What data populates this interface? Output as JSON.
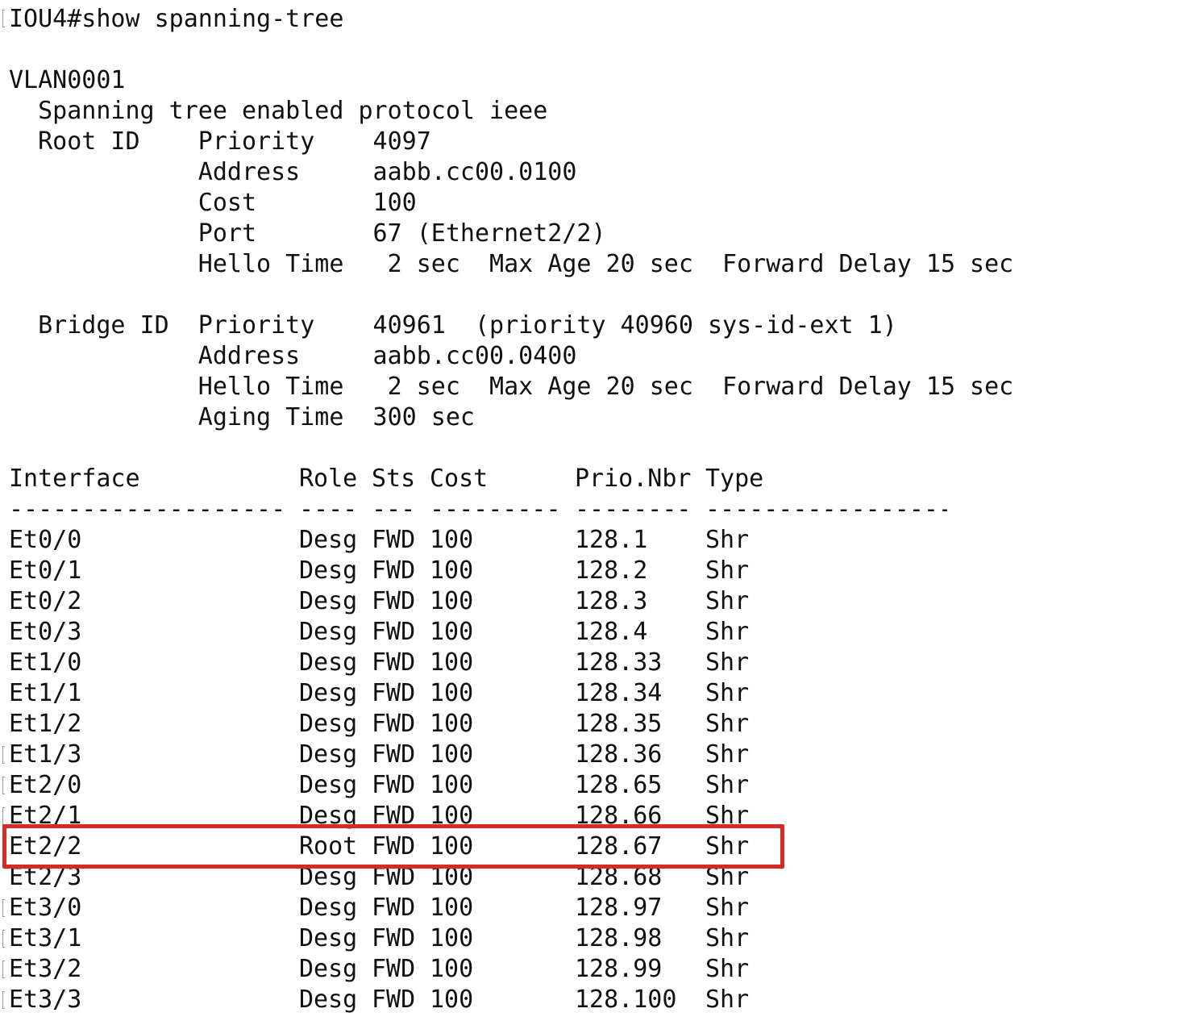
{
  "prompt_line": "IOU4#show spanning-tree",
  "vlan": {
    "name": "VLAN0001",
    "protocol_line": "  Spanning tree enabled protocol ieee",
    "root_lines": [
      "  Root ID    Priority    4097",
      "             Address     aabb.cc00.0100",
      "             Cost        100",
      "             Port        67 (Ethernet2/2)",
      "             Hello Time   2 sec  Max Age 20 sec  Forward Delay 15 sec"
    ],
    "bridge_lines": [
      "  Bridge ID  Priority    40961  (priority 40960 sys-id-ext 1)",
      "             Address     aabb.cc00.0400",
      "             Hello Time   2 sec  Max Age 20 sec  Forward Delay 15 sec",
      "             Aging Time  300 sec"
    ]
  },
  "table": {
    "headers": {
      "interface": "Interface",
      "role": "Role",
      "sts": "Sts",
      "cost": "Cost",
      "prio": "Prio.Nbr",
      "type": "Type"
    },
    "separators": {
      "interface": "-------------------",
      "role": "----",
      "sts": "---",
      "cost": "---------",
      "prio": "--------",
      "type": "--------------------------------"
    },
    "rows": [
      {
        "interface": "Et0/0",
        "role": "Desg",
        "sts": "FWD",
        "cost": "100",
        "prio": "128.1",
        "type": "Shr"
      },
      {
        "interface": "Et0/1",
        "role": "Desg",
        "sts": "FWD",
        "cost": "100",
        "prio": "128.2",
        "type": "Shr"
      },
      {
        "interface": "Et0/2",
        "role": "Desg",
        "sts": "FWD",
        "cost": "100",
        "prio": "128.3",
        "type": "Shr"
      },
      {
        "interface": "Et0/3",
        "role": "Desg",
        "sts": "FWD",
        "cost": "100",
        "prio": "128.4",
        "type": "Shr"
      },
      {
        "interface": "Et1/0",
        "role": "Desg",
        "sts": "FWD",
        "cost": "100",
        "prio": "128.33",
        "type": "Shr"
      },
      {
        "interface": "Et1/1",
        "role": "Desg",
        "sts": "FWD",
        "cost": "100",
        "prio": "128.34",
        "type": "Shr"
      },
      {
        "interface": "Et1/2",
        "role": "Desg",
        "sts": "FWD",
        "cost": "100",
        "prio": "128.35",
        "type": "Shr"
      },
      {
        "interface": "Et1/3",
        "role": "Desg",
        "sts": "FWD",
        "cost": "100",
        "prio": "128.36",
        "type": "Shr"
      },
      {
        "interface": "Et2/0",
        "role": "Desg",
        "sts": "FWD",
        "cost": "100",
        "prio": "128.65",
        "type": "Shr"
      },
      {
        "interface": "Et2/1",
        "role": "Desg",
        "sts": "FWD",
        "cost": "100",
        "prio": "128.66",
        "type": "Shr"
      },
      {
        "interface": "Et2/2",
        "role": "Root",
        "sts": "FWD",
        "cost": "100",
        "prio": "128.67",
        "type": "Shr"
      },
      {
        "interface": "Et2/3",
        "role": "Desg",
        "sts": "FWD",
        "cost": "100",
        "prio": "128.68",
        "type": "Shr"
      },
      {
        "interface": "Et3/0",
        "role": "Desg",
        "sts": "FWD",
        "cost": "100",
        "prio": "128.97",
        "type": "Shr"
      },
      {
        "interface": "Et3/1",
        "role": "Desg",
        "sts": "FWD",
        "cost": "100",
        "prio": "128.98",
        "type": "Shr"
      },
      {
        "interface": "Et3/2",
        "role": "Desg",
        "sts": "FWD",
        "cost": "100",
        "prio": "128.99",
        "type": "Shr"
      },
      {
        "interface": "Et3/3",
        "role": "Desg",
        "sts": "FWD",
        "cost": "100",
        "prio": "128.100",
        "type": "Shr"
      }
    ]
  },
  "highlight": {
    "row_interface": "Et2/2",
    "color": "#d62a22"
  },
  "colors": {
    "text": "#111111",
    "background": "#ffffff",
    "tick": "#9a9a9a"
  }
}
